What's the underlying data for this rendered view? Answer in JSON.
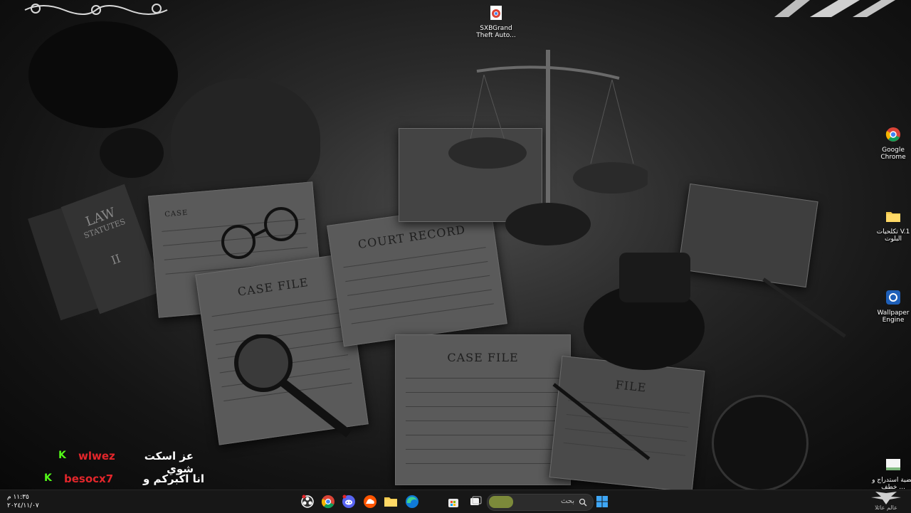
{
  "desktop_icons": {
    "sxb": {
      "label": "SXBGrand Theft Auto..."
    },
    "chrome": {
      "label": "Google Chrome"
    },
    "folder": {
      "label": "تكلحيات V.1 البلوت"
    },
    "wallpaper_engine": {
      "label": "Wallpaper Engine"
    },
    "doc": {
      "label": "قضية استدراج و خطف ..."
    }
  },
  "wallpaper_text": {
    "case_file_1": "CASE FILE",
    "case_file_2": "CASE FILE",
    "court_record": "COURT RECORD",
    "case_small": "CASE",
    "file_small": "FILE",
    "law_book": "LAW",
    "statutes": "STATUTES",
    "volume": "II"
  },
  "chat_overlay": {
    "line1": {
      "badge": "K",
      "user": "wlwez",
      "message": "عز اسكت شوي"
    },
    "line2": {
      "badge": "K",
      "user": "besocx7",
      "message": "انا اكبركم و بسس"
    }
  },
  "taskbar": {
    "search_placeholder": "بحث",
    "clock_time": "١١:٣٥ م",
    "clock_date": "٢٠٢٤/١١/٠٧",
    "tray_label": "عالم عائلا"
  },
  "colors": {
    "badge_green": "#53fc18",
    "user_red": "#e3262b",
    "taskbar_bg": "#171717"
  }
}
